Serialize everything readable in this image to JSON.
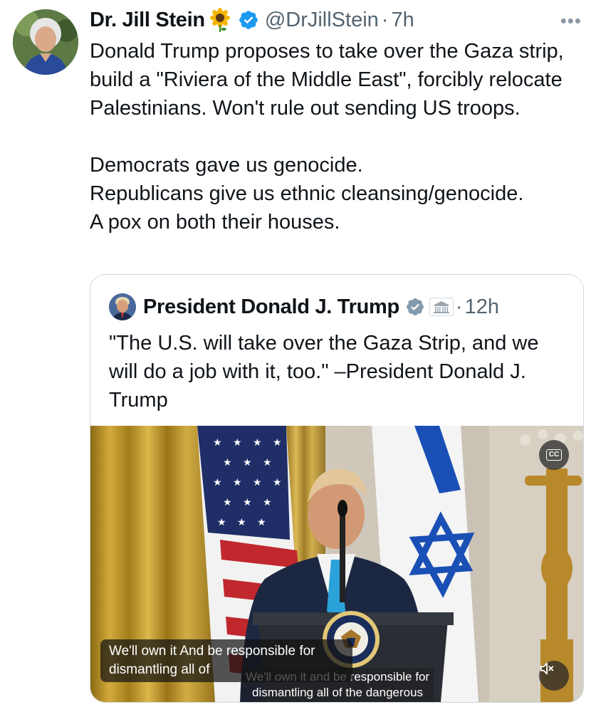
{
  "tweet": {
    "name": "Dr. Jill Stein",
    "handle": "@DrJillStein",
    "dot": "·",
    "time": "7h",
    "more": "•••",
    "text": "Donald Trump proposes to take over the Gaza strip, build a \"Riviera of the Middle East\", forcibly relocate Palestinians. Won't rule out sending US troops.\n\nDemocrats gave us genocide.\nRepublicans give us ethnic cleansing/genocide.\nA pox on both their houses."
  },
  "quote": {
    "name": "President Donald J. Trump",
    "dot": "·",
    "time": "12h",
    "text": "\"The U.S. will take over the Gaza Strip, and we will do a job with it, too.\" –President Donald J. Trump",
    "media": {
      "caption": "We'll own it And be responsible for dismantling all of",
      "burned_caption_line1": "We'll own it and be responsible for",
      "burned_caption_line2": "dismantling all of the dangerous",
      "cc_label": "CC"
    }
  },
  "icons": {
    "sunflower": "sunflower-icon",
    "verified": "verified-badge-icon",
    "government": "white-house-icon",
    "cc": "closed-captions-icon",
    "mute": "muted-speaker-icon"
  },
  "colors": {
    "verified": "#1d9bf0",
    "secondary_text": "#536471",
    "border": "#cfd9de"
  }
}
